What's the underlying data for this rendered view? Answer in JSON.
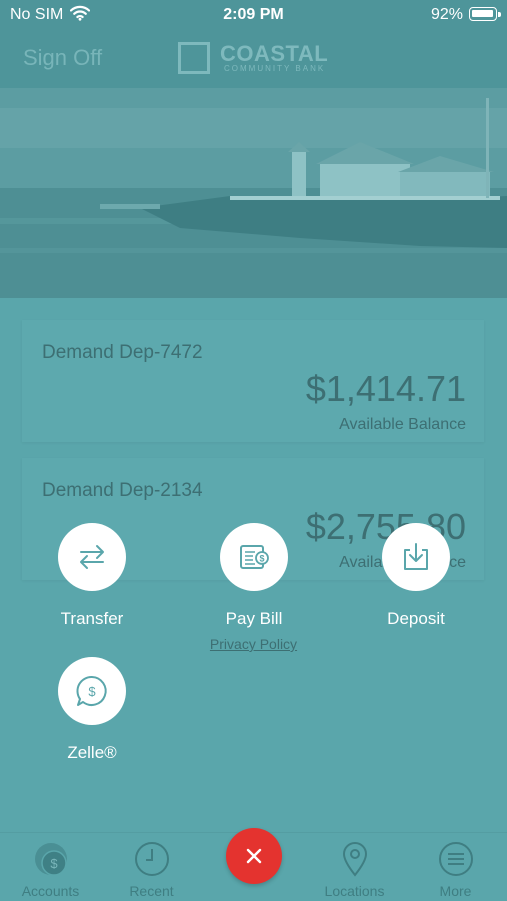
{
  "status_bar": {
    "carrier": "No SIM",
    "time": "2:09 PM",
    "battery": "92%"
  },
  "nav": {
    "sign_off": "Sign Off",
    "logo_name": "COASTAL",
    "logo_sub": "COMMUNITY BANK"
  },
  "accounts": [
    {
      "name": "Demand Dep-7472",
      "balance": "$1,414.71",
      "caption": "Available Balance"
    },
    {
      "name": "Demand Dep-2134",
      "balance": "$2,755.80",
      "caption": "Available Balance"
    }
  ],
  "privacy_policy": "Privacy Policy",
  "actions": {
    "transfer": {
      "label": "Transfer",
      "icon": "transfer-arrows-icon"
    },
    "pay_bill": {
      "label": "Pay Bill",
      "icon": "bill-icon"
    },
    "deposit": {
      "label": "Deposit",
      "icon": "download-tray-icon"
    },
    "zelle": {
      "label": "Zelle®",
      "icon": "dollar-chat-icon"
    }
  },
  "tabs": [
    {
      "label": "Accounts",
      "icon": "dollar-coin-icon"
    },
    {
      "label": "Recent",
      "icon": "clock-icon"
    },
    {
      "label": "Locations",
      "icon": "map-pin-icon"
    },
    {
      "label": "More",
      "icon": "menu-icon"
    }
  ],
  "colors": {
    "overlay_teal": "#5aa6ab",
    "close_button": "#e4332f",
    "action_circle": "#ffffff"
  }
}
